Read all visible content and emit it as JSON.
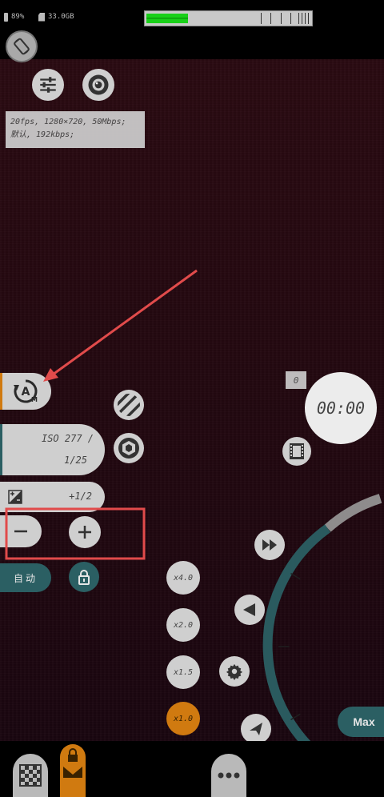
{
  "status_bar": {
    "battery_text": "89%",
    "storage_text": "33.0GB",
    "level_percent": 25
  },
  "info_box": {
    "line1": "20fps, 1280×720, 50Mbps;",
    "line2": "默认, 192kbps;"
  },
  "exposure": {
    "iso_label": "ISO 277 /",
    "shutter_label": "1/25",
    "ev_label": "+1/2"
  },
  "auto_button_label": "自动",
  "counter_label": "0",
  "record_time": "00:00",
  "zoom_levels": [
    "x4.0",
    "x2.0",
    "x1.5",
    "x1.0"
  ],
  "max_label": "Max",
  "colors": {
    "accent_teal": "#2b5f63",
    "zoom_active": "#d07a10",
    "annotation_red": "#e14b4b"
  }
}
